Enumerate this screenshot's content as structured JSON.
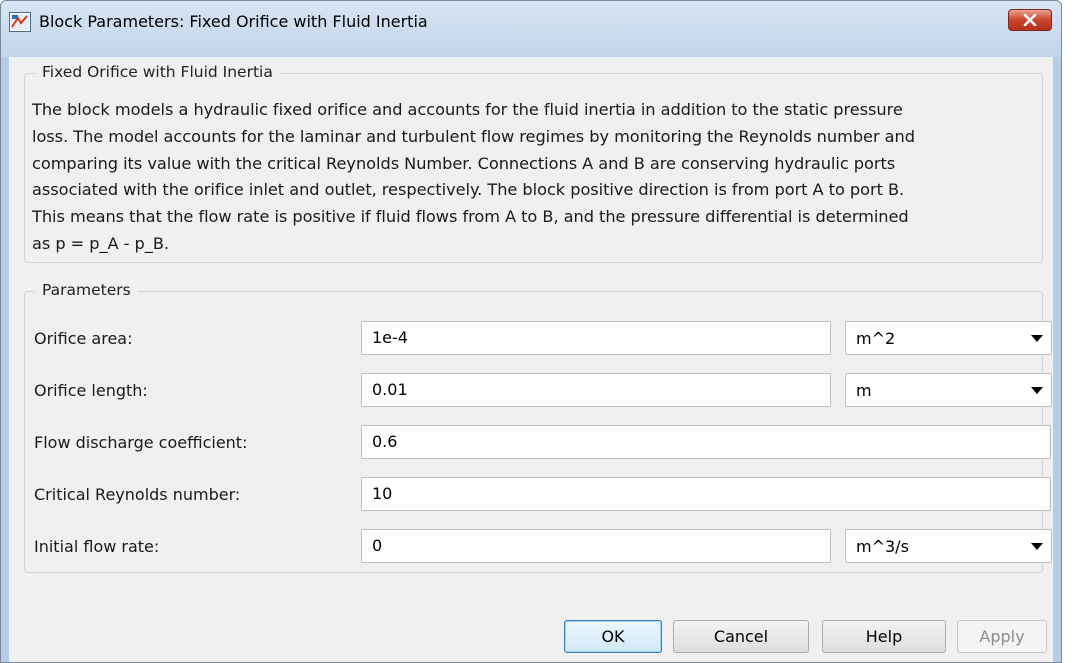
{
  "window": {
    "title": "Block Parameters: Fixed Orifice with Fluid Inertia",
    "icons": {
      "app": "simulink-block-icon",
      "close": "close-icon"
    },
    "colors": {
      "close_button": "#c9452e",
      "titlebar": "#c2d5ea",
      "client_bg": "#f0f0f0"
    }
  },
  "description": {
    "legend": "Fixed Orifice with Fluid Inertia",
    "lines": [
      "The block models a hydraulic fixed orifice and accounts for the fluid inertia in addition to the static pressure",
      "loss. The model accounts for the laminar and turbulent flow regimes by monitoring the Reynolds number and",
      "comparing its value with the critical Reynolds Number. Connections A and B are conserving hydraulic ports",
      "associated with the orifice inlet and outlet, respectively. The block positive direction is from port A to port B.",
      "This means that the flow rate is positive if fluid flows from A to B, and the pressure differential is determined",
      "as p = p_A - p_B."
    ]
  },
  "parameters": {
    "legend": "Parameters",
    "rows": [
      {
        "label": "Orifice area:",
        "value": "1e-4",
        "unit": "m^2"
      },
      {
        "label": "Orifice length:",
        "value": "0.01",
        "unit": "m"
      },
      {
        "label": "Flow discharge coefficient:",
        "value": "0.6"
      },
      {
        "label": "Critical Reynolds number:",
        "value": "10"
      },
      {
        "label": "Initial flow rate:",
        "value": "0",
        "unit": "m^3/s"
      }
    ]
  },
  "buttons": {
    "ok": "OK",
    "cancel": "Cancel",
    "help": "Help",
    "apply": "Apply"
  }
}
